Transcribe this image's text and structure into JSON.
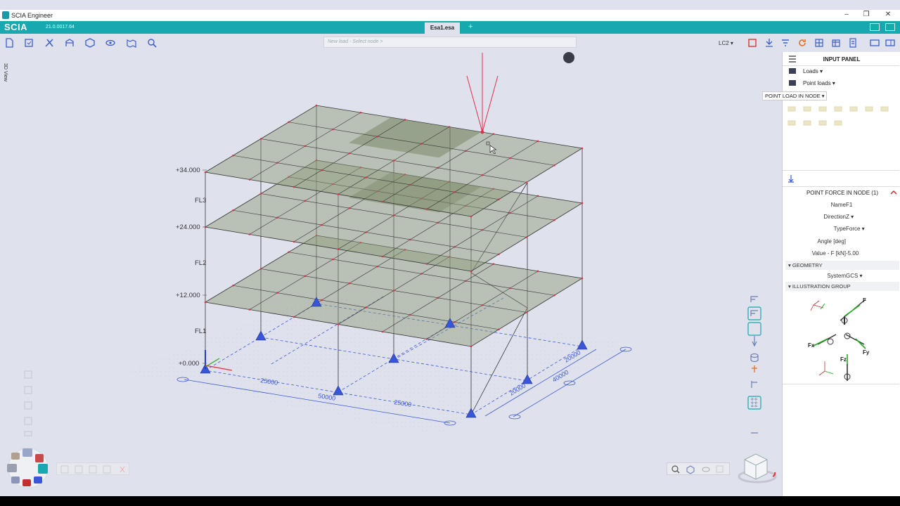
{
  "window": {
    "title": "SCIA Engineer",
    "brand": "SCIA",
    "version": "21.0.0017.64",
    "tab": "Esa1.esa",
    "tab_add": "+"
  },
  "toolbar": {
    "command_placeholder": "New load - Select node >",
    "load_case": "LC2 ▾",
    "tools": [
      "new-icon",
      "open-icon",
      "tools-icon",
      "structure-icon",
      "model-icon",
      "view-icon",
      "map-icon",
      "search-icon"
    ]
  },
  "viewport": {
    "view_label": "3D View",
    "levels": [
      {
        "elev": "+34.000",
        "floor": "FL3"
      },
      {
        "elev": "+24.000",
        "floor": "FL2"
      },
      {
        "elev": "+12.000",
        "floor": "FL1"
      },
      {
        "elev": "+0.000",
        "floor": ""
      }
    ],
    "dimensions": {
      "d1": "25000",
      "d2": "50000",
      "d3": "25000",
      "d4": "20000",
      "d5": "40000",
      "d6": "20000"
    }
  },
  "panel": {
    "title": "INPUT PANEL",
    "loads": "Loads ▾",
    "point_loads": "Point loads ▾",
    "command": "POINT LOAD IN NODE ▾",
    "props_title": "POINT FORCE IN NODE (1)",
    "props": [
      {
        "label": "Name",
        "value": "F1"
      },
      {
        "label": "Direction",
        "value": "Z ▾"
      },
      {
        "label": "Type",
        "value": "Force ▾"
      },
      {
        "label": "Angle [deg]",
        "value": ""
      },
      {
        "label": "Value - F [kN]",
        "value": "-5.00"
      }
    ],
    "geometry_section": "GEOMETRY",
    "system_label": "System",
    "system_value": "GCS ▾",
    "illustration_section": "ILLUSTRATION GROUP",
    "illus_labels": {
      "fx": "Fx",
      "f": "F",
      "fy": "Fy",
      "fz": "Fz"
    }
  },
  "colors": {
    "accent": "#17a8b0",
    "slab": "#8c9a78",
    "load": "#e0304a",
    "support": "#3a56d8"
  }
}
